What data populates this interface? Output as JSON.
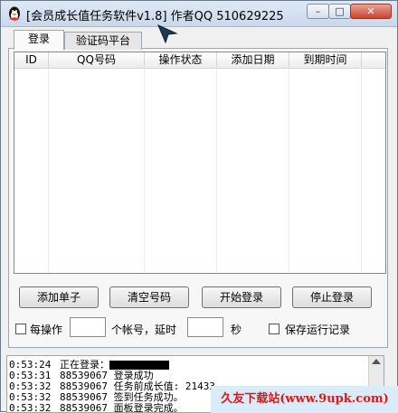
{
  "window": {
    "title": "[会员成长值任务软件v1.8]  作者QQ 510629225"
  },
  "tabs": [
    {
      "label": "登录"
    },
    {
      "label": "验证码平台"
    }
  ],
  "table": {
    "columns": [
      "ID",
      "QQ号码",
      "操作状态",
      "添加日期",
      "到期时间"
    ]
  },
  "buttons": {
    "add": "添加单子",
    "clear": "清空号码",
    "start": "开始登录",
    "stop": "停止登录"
  },
  "options": {
    "each_op_label": "每操作",
    "per_account_label": "个帐号，延时",
    "seconds_label": "秒",
    "save_log_label": "保存运行记录"
  },
  "log": [
    {
      "time": "0:53:24",
      "text": "正在登录："
    },
    {
      "time": "0:53:31",
      "text": "88539067 登录成功"
    },
    {
      "time": "0:53:32",
      "text": "88539067 任务前成长值: 21433"
    },
    {
      "time": "0:53:32",
      "text": "88539067 签到任务成功。"
    },
    {
      "time": "0:53:32",
      "text": "88539067 面板登录完成。"
    }
  ],
  "watermark": "久友下载站(www.9upk.com)"
}
